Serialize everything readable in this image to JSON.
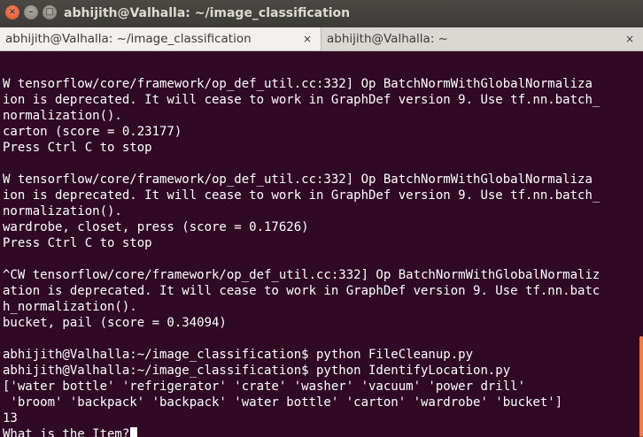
{
  "window": {
    "title": "abhijith@Valhalla: ~/image_classification",
    "controls": {
      "close": "×",
      "minimize": "–",
      "maximize": "□"
    }
  },
  "tabs": [
    {
      "label": "abhijith@Valhalla: ~/image_classification",
      "close": "×",
      "active": true
    },
    {
      "label": "abhijith@Valhalla: ~",
      "close": "×",
      "active": false
    }
  ],
  "terminal": {
    "lines": [
      "W tensorflow/core/framework/op_def_util.cc:332] Op BatchNormWithGlobalNormaliza",
      "ion is deprecated. It will cease to work in GraphDef version 9. Use tf.nn.batch_",
      "normalization().",
      "carton (score = 0.23177)",
      "Press Ctrl C to stop",
      "",
      "W tensorflow/core/framework/op_def_util.cc:332] Op BatchNormWithGlobalNormaliza",
      "ion is deprecated. It will cease to work in GraphDef version 9. Use tf.nn.batch_",
      "normalization().",
      "wardrobe, closet, press (score = 0.17626)",
      "Press Ctrl C to stop",
      "",
      "^CW tensorflow/core/framework/op_def_util.cc:332] Op BatchNormWithGlobalNormaliz",
      "ation is deprecated. It will cease to work in GraphDef version 9. Use tf.nn.batc",
      "h_normalization().",
      "bucket, pail (score = 0.34094)",
      "",
      "abhijith@Valhalla:~/image_classification$ python FileCleanup.py",
      "abhijith@Valhalla:~/image_classification$ python IdentifyLocation.py",
      "['water bottle' 'refrigerator' 'crate' 'washer' 'vacuum' 'power drill'",
      " 'broom' 'backpack' 'backpack' 'water bottle' 'carton' 'wardrobe' 'bucket']",
      "13",
      "What is the Item?"
    ]
  },
  "colors": {
    "terminal_bg": "#300a24",
    "terminal_fg": "#ffffff",
    "titlebar_bg": "#3c3b37",
    "close_button": "#df4b16",
    "scrollbar": "#f07746"
  }
}
